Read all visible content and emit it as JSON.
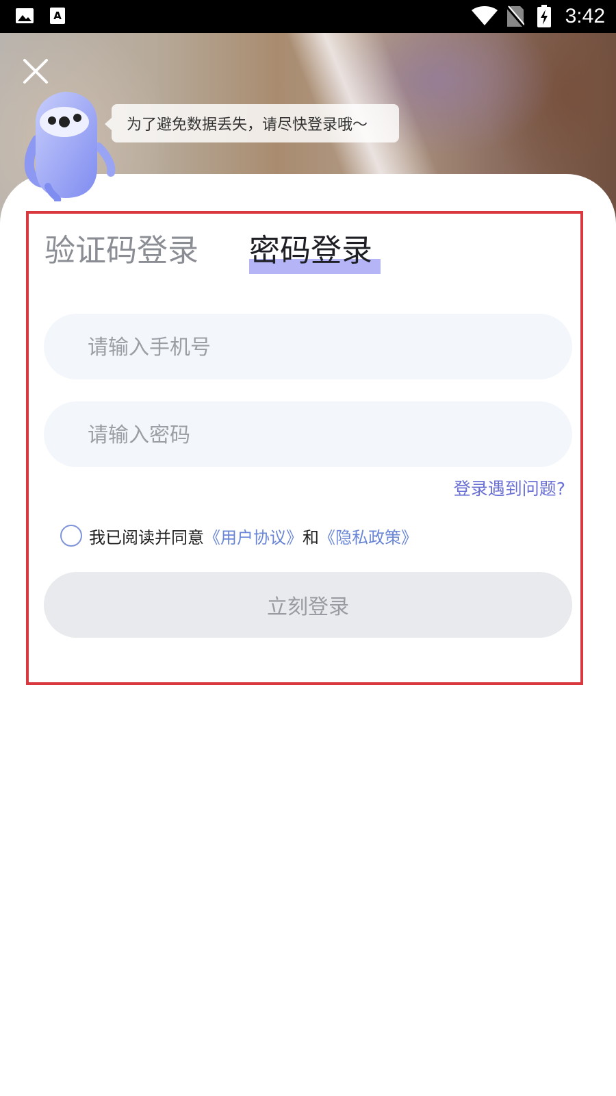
{
  "status_bar": {
    "time": "3:42",
    "left_icons": [
      "image-icon",
      "font-download-icon"
    ],
    "right_icons": [
      "wifi-icon",
      "no-sim-icon",
      "battery-charging-icon"
    ]
  },
  "header": {
    "tooltip": "为了避免数据丢失，请尽快登录哦～",
    "close_icon": "close-icon"
  },
  "tabs": [
    {
      "label": "验证码登录",
      "active": false
    },
    {
      "label": "密码登录",
      "active": true
    }
  ],
  "form": {
    "phone_placeholder": "请输入手机号",
    "password_placeholder": "请输入密码",
    "help_link": "登录遇到问题?",
    "agreement": {
      "prefix": "我已阅读并同意",
      "user_agreement": "《用户协议》",
      "and": "和",
      "privacy_policy": "《隐私政策》",
      "checked": false
    },
    "submit_label": "立刻登录"
  },
  "colors": {
    "accent_link": "#6a70d3",
    "tab_underline": "#b4b4f6",
    "highlight_frame": "#d9393e",
    "field_bg": "#f3f6fa",
    "button_bg": "#e9eaed"
  }
}
